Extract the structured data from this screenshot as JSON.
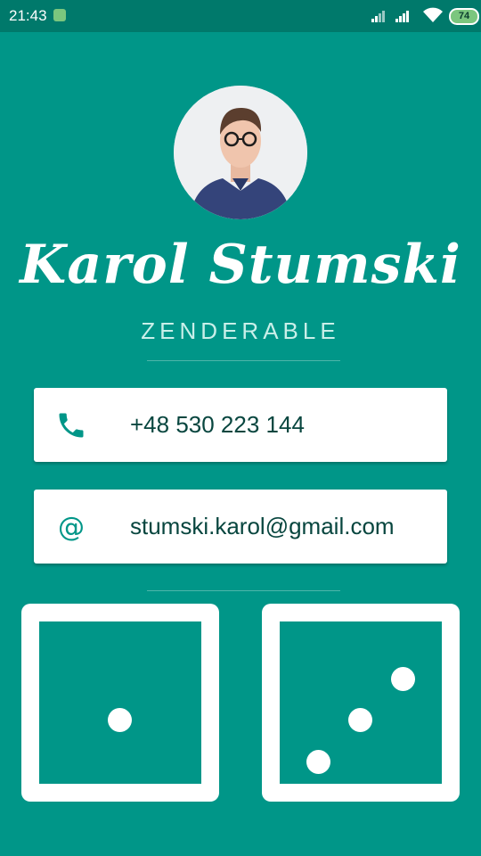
{
  "status_bar": {
    "time": "21:43",
    "battery": "74",
    "icons": [
      "app-notification-icon",
      "signal-icon",
      "signal-icon",
      "wifi-icon",
      "battery-icon"
    ]
  },
  "profile": {
    "name": "Karol Stumski",
    "company": "ZENDERABLE"
  },
  "contacts": {
    "phone": {
      "icon": "phone-icon",
      "value": "+48 530 223 144"
    },
    "email": {
      "icon": "at-icon",
      "value": "stumski.karol@gmail.com"
    }
  },
  "dice": [
    {
      "value": 1
    },
    {
      "value": 3
    }
  ],
  "colors": {
    "background": "#009688",
    "status_bar": "#00796B",
    "card": "#FFFFFF",
    "text_dark": "#08463F"
  }
}
